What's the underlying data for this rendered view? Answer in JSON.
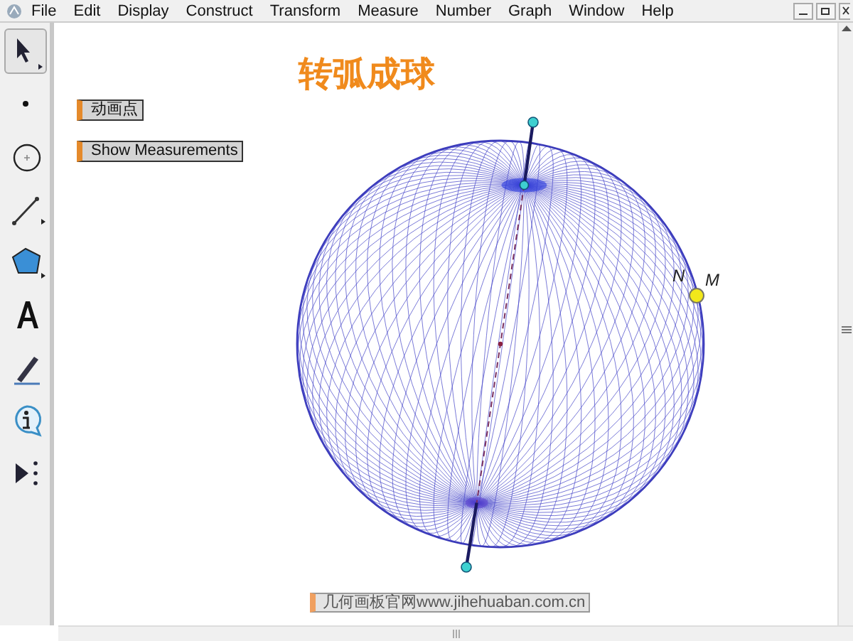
{
  "menu": [
    "File",
    "Edit",
    "Display",
    "Construct",
    "Transform",
    "Measure",
    "Number",
    "Graph",
    "Window",
    "Help"
  ],
  "tools": [
    {
      "kind": "arrow",
      "selected": true
    },
    {
      "kind": "point",
      "selected": false
    },
    {
      "kind": "compass",
      "selected": false
    },
    {
      "kind": "line",
      "selected": false
    },
    {
      "kind": "polygon",
      "selected": false
    },
    {
      "kind": "text",
      "selected": false
    },
    {
      "kind": "marker",
      "selected": false
    },
    {
      "kind": "info",
      "selected": false
    },
    {
      "kind": "custom",
      "selected": false
    }
  ],
  "sketch": {
    "title": "转弧成球",
    "buttons": [
      "动画点",
      "Show Measurements"
    ],
    "point_labels": [
      "N",
      "M"
    ],
    "caption": "几何画板官网www.jihehuaban.com.cn"
  }
}
